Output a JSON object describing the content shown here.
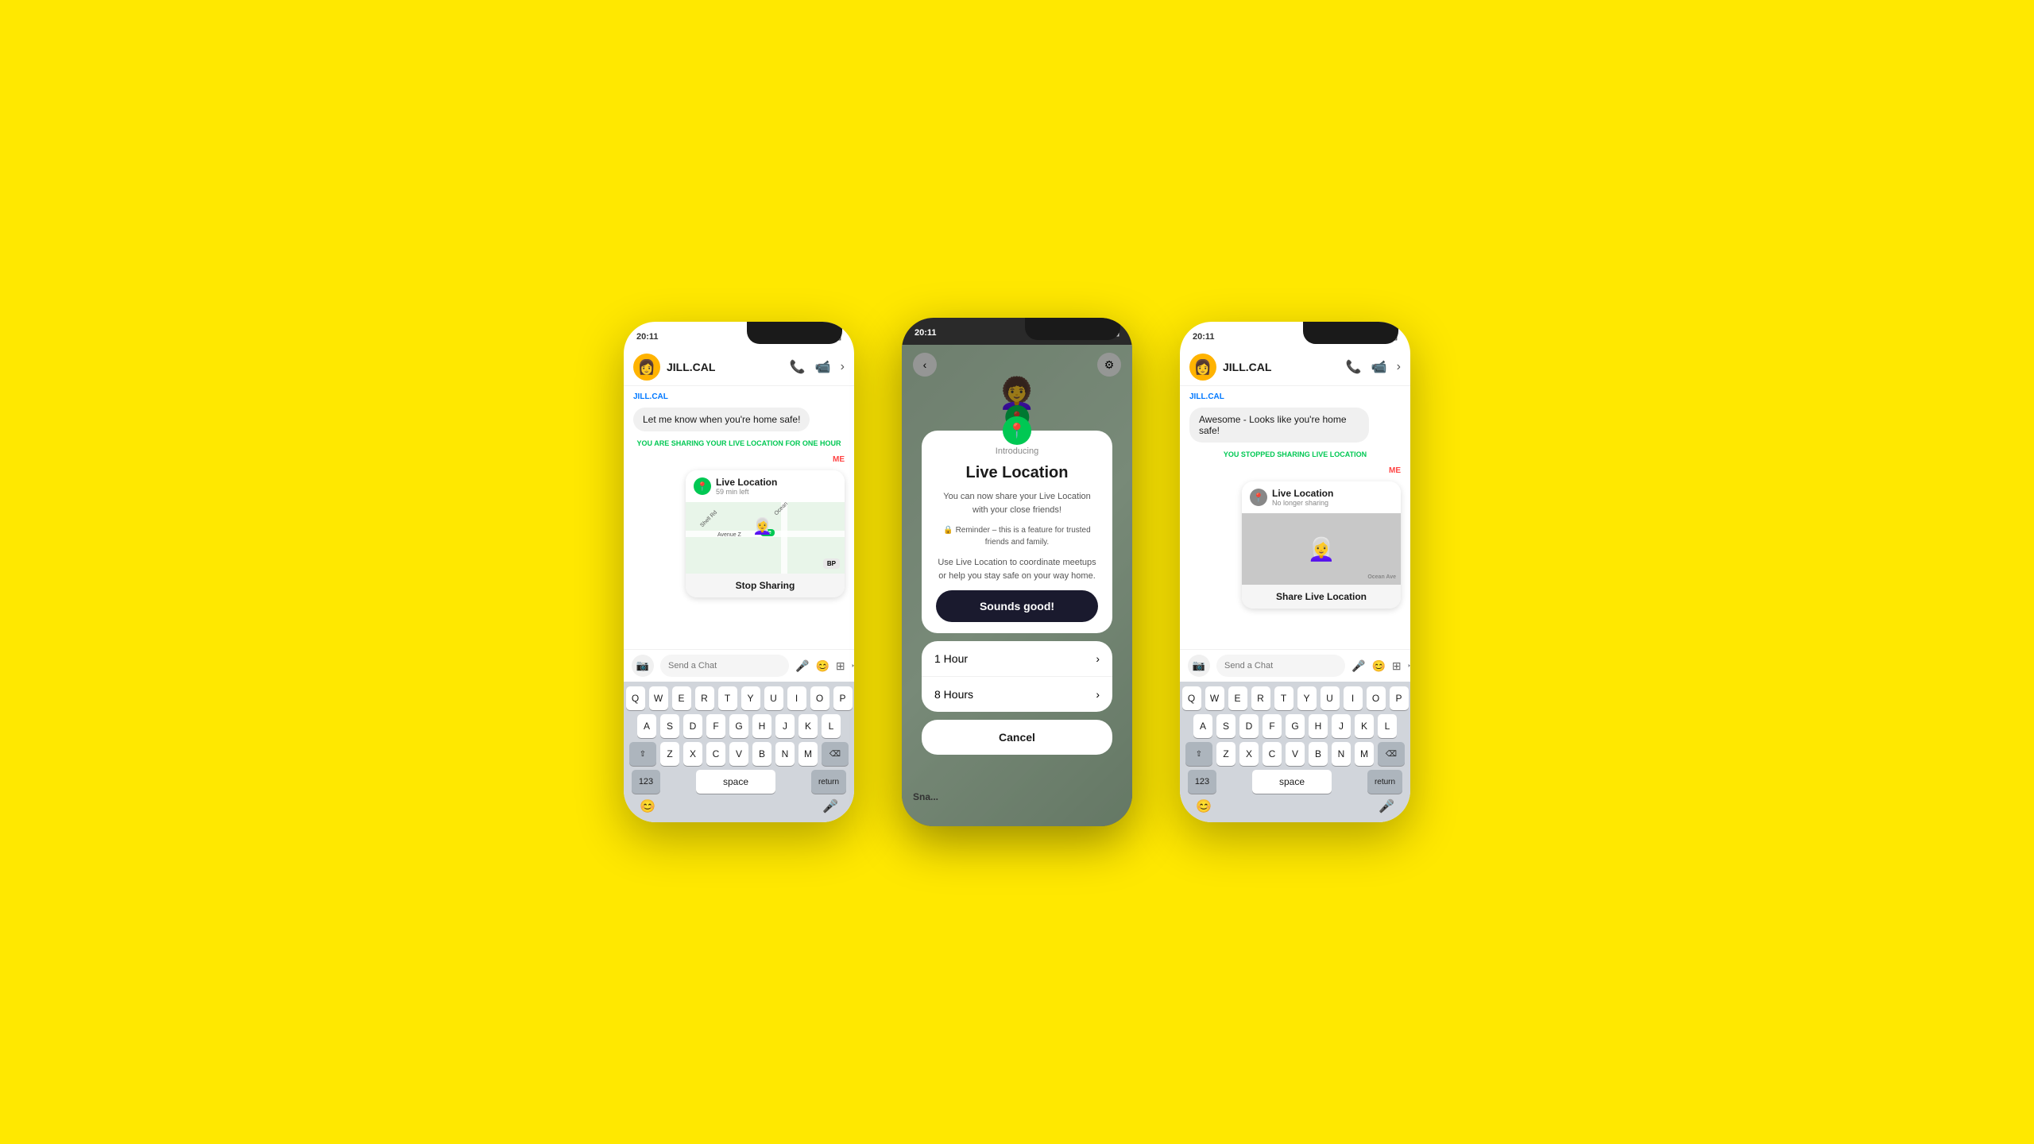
{
  "bg_color": "#FFE800",
  "phone1": {
    "status_time": "20:11",
    "contact_name": "JILL.CAL",
    "contact_label": "JILL.CAL",
    "message_text": "Let me know when you're home safe!",
    "system_message": "YOU ARE SHARING YOUR",
    "system_highlight": "LIVE LOCATION",
    "system_suffix": "FOR ONE HOUR",
    "me_label": "ME",
    "live_location_title": "Live Location",
    "live_location_subtitle": "59 min left",
    "stop_sharing": "Stop Sharing",
    "send_chat_placeholder": "Send a Chat",
    "keys_row1": [
      "Q",
      "W",
      "E",
      "R",
      "T",
      "Y",
      "U",
      "I",
      "O",
      "P"
    ],
    "keys_row2": [
      "A",
      "S",
      "D",
      "F",
      "G",
      "H",
      "J",
      "K",
      "L"
    ],
    "keys_row3": [
      "Z",
      "X",
      "C",
      "V",
      "B",
      "N",
      "M"
    ],
    "key_123": "123",
    "key_space": "space",
    "key_return": "return"
  },
  "phone2": {
    "status_time": "20:11",
    "back_icon": "‹",
    "settings_icon": "⚙",
    "introducing_label": "Introducing",
    "modal_title": "Live Location",
    "modal_desc": "You can now share your Live Location with your close friends!",
    "modal_reminder": "🔒 Reminder – this is a feature for trusted friends and family.",
    "modal_use": "Use Live Location to coordinate meetups or help you stay safe on your way home.",
    "cta_label": "Sounds good!",
    "duration_1": "1 Hour",
    "duration_2": "8 Hours",
    "cancel_label": "Cancel"
  },
  "phone3": {
    "status_time": "20:11",
    "contact_name": "JILL.CAL",
    "contact_label": "JILL.CAL",
    "message_text": "Awesome - Looks like you're home safe!",
    "system_message": "YOU STOPPED SHARING LIVE LOCATION",
    "me_label": "ME",
    "live_location_title": "Live Location",
    "live_location_subtitle": "No longer sharing",
    "share_location_btn": "Share Live Location",
    "send_chat_placeholder": "Send a Chat",
    "keys_row1": [
      "Q",
      "W",
      "E",
      "R",
      "T",
      "Y",
      "U",
      "I",
      "O",
      "P"
    ],
    "keys_row2": [
      "A",
      "S",
      "D",
      "F",
      "G",
      "H",
      "J",
      "K",
      "L"
    ],
    "keys_row3": [
      "Z",
      "X",
      "C",
      "V",
      "B",
      "N",
      "M"
    ],
    "key_123": "123",
    "key_space": "space",
    "key_return": "return"
  }
}
